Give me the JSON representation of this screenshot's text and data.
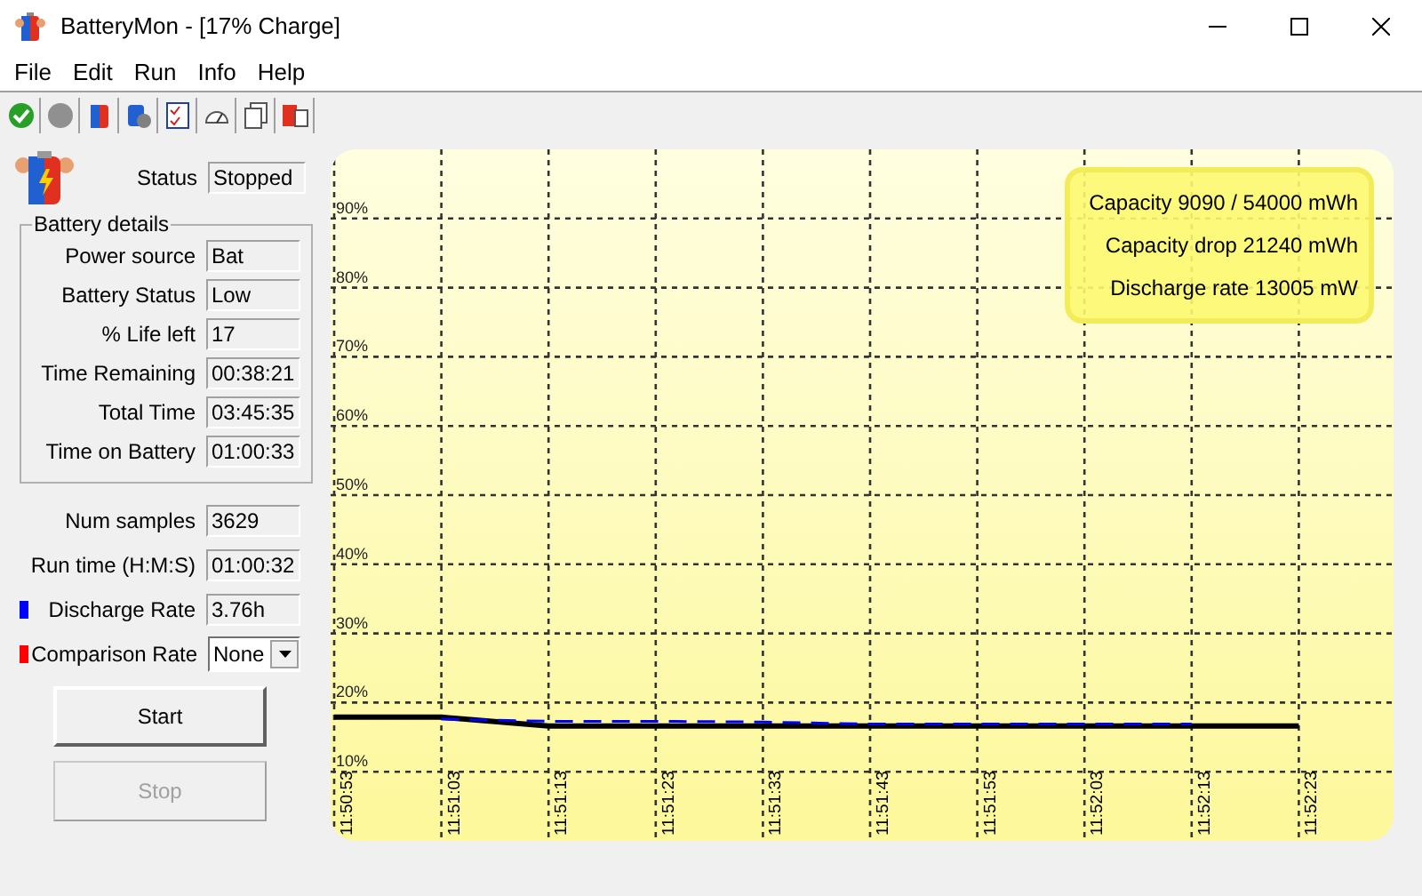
{
  "window": {
    "title": "BatteryMon - [17% Charge]"
  },
  "menu": [
    "File",
    "Edit",
    "Run",
    "Info",
    "Help"
  ],
  "status": {
    "label": "Status",
    "value": "Stopped"
  },
  "battery_details": {
    "title": "Battery details",
    "fields": [
      {
        "label": "Power source",
        "value": "Bat"
      },
      {
        "label": "Battery Status",
        "value": "Low"
      },
      {
        "label": "% Life left",
        "value": "17"
      },
      {
        "label": "Time Remaining",
        "value": "00:38:21"
      },
      {
        "label": "Total Time",
        "value": "03:45:35"
      },
      {
        "label": "Time on Battery",
        "value": "01:00:33"
      }
    ]
  },
  "stats": [
    {
      "kind": "field",
      "label": "Num samples",
      "value": "3629"
    },
    {
      "kind": "field",
      "label": "Run time (H:M:S)",
      "value": "01:00:32"
    },
    {
      "kind": "field",
      "label": "Discharge Rate",
      "value": "3.76h",
      "color": "#0000ff"
    },
    {
      "kind": "dropdown",
      "label": "Comparison Rate",
      "value": "None",
      "color": "#ff0000"
    }
  ],
  "buttons": [
    {
      "label": "Start",
      "disabled": false
    },
    {
      "label": "Stop",
      "disabled": true
    }
  ],
  "info_box": [
    "Capacity 9090 / 54000 mWh",
    "Capacity drop 21240 mWh",
    "Discharge rate 13005 mW"
  ],
  "chart_data": {
    "type": "line",
    "ylim": [
      0,
      100
    ],
    "grid": true,
    "categories": [
      "11:50:53",
      "11:51:03",
      "11:51:13",
      "11:51:23",
      "11:51:33",
      "11:51:43",
      "11:51:53",
      "11:52:03",
      "11:52:13",
      "11:52:23"
    ],
    "yticks": [
      {
        "value": 10,
        "label": "10%"
      },
      {
        "value": 20,
        "label": "20%"
      },
      {
        "value": 30,
        "label": "30%"
      },
      {
        "value": 40,
        "label": "40%"
      },
      {
        "value": 50,
        "label": "50%"
      },
      {
        "value": 60,
        "label": "60%"
      },
      {
        "value": 70,
        "label": "70%"
      },
      {
        "value": 80,
        "label": "80%"
      },
      {
        "value": 90,
        "label": "90%"
      }
    ],
    "series": [
      {
        "color": "#000000",
        "line_style": "solid",
        "values": [
          17.9,
          17.9,
          16.6,
          16.6,
          16.6,
          16.6,
          16.6,
          16.6,
          16.6,
          16.6
        ]
      },
      {
        "color": "#0000ff",
        "line_style": "dashed",
        "values": [
          null,
          17.6,
          17.3,
          17.3,
          17.2,
          16.9,
          16.9,
          16.9,
          16.9,
          null
        ]
      }
    ]
  }
}
